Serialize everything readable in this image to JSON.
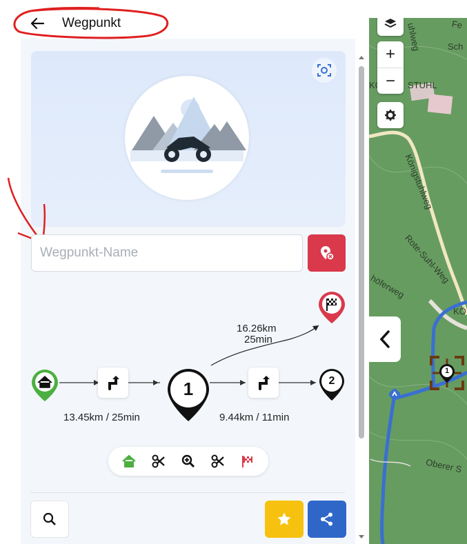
{
  "header": {
    "title": "Wegpunkt"
  },
  "form": {
    "name_placeholder": "Wegpunkt-Name",
    "name_value": ""
  },
  "route": {
    "left_segment": "13.45km / 25min",
    "right_segment": "9.44km / 11min",
    "branch_distance": "16.26km",
    "branch_time": "25min",
    "current_number": "1",
    "next_number": "2"
  },
  "map": {
    "zoom_in": "+",
    "zoom_out": "−",
    "streets": [
      "Fe",
      "Sch",
      "uhlweg",
      "KÖ",
      "STUHL",
      "Königstuhlweg",
      "Rote-Suhl-Weg",
      "höferweg",
      "KÖ",
      "Oberer S"
    ],
    "marker_number": "1"
  },
  "colors": {
    "home": "#4caf3f",
    "danger": "#d9394b",
    "favorite": "#f6c20f",
    "share": "#2f67c9",
    "route_line": "#3a6fd1"
  },
  "icons": [
    "back-arrow-icon",
    "scan-icon",
    "motorbike-icon",
    "pin-delete-icon",
    "home-pin-icon",
    "turn-icon",
    "waypoint-pin-icon",
    "finish-flag-pin-icon",
    "scissors-icon",
    "zoom-in-icon",
    "search-icon",
    "star-icon",
    "share-icon",
    "layers-icon",
    "gear-icon",
    "chevron-left-icon"
  ]
}
